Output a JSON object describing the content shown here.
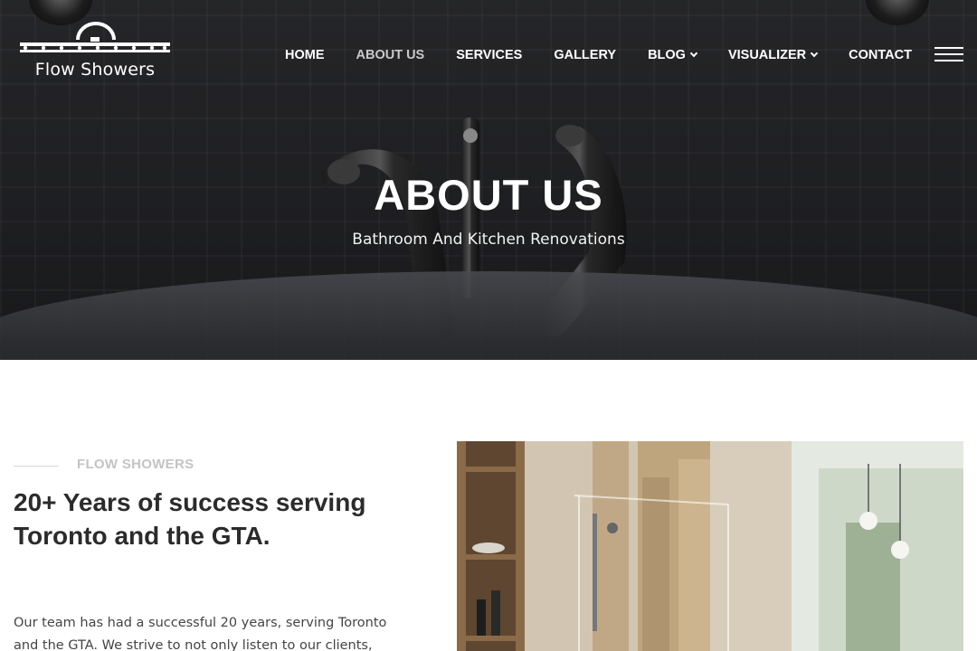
{
  "brand": {
    "name": "Flow Showers"
  },
  "nav": {
    "items": [
      {
        "label": "HOME",
        "active": false,
        "dropdown": false
      },
      {
        "label": "ABOUT US",
        "active": true,
        "dropdown": false
      },
      {
        "label": "SERVICES",
        "active": false,
        "dropdown": false
      },
      {
        "label": "GALLERY",
        "active": false,
        "dropdown": false
      },
      {
        "label": "BLOG",
        "active": false,
        "dropdown": true
      },
      {
        "label": "VISUALIZER",
        "active": false,
        "dropdown": true
      },
      {
        "label": "CONTACT",
        "active": false,
        "dropdown": false
      }
    ],
    "menu_icon": "hamburger-menu-icon"
  },
  "hero": {
    "title": "ABOUT US",
    "subtitle": "Bathroom And Kitchen Renovations"
  },
  "intro": {
    "eyebrow": "FLOW SHOWERS",
    "heading": "20+ Years of success serving Toronto and the GTA.",
    "paragraph": "Our team has had a successful 20 years, serving Toronto and the GTA. We strive to not only listen to our clients,"
  },
  "colors": {
    "hero_overlay": "#1e1f22",
    "nav_text": "#ffffff",
    "nav_active": "#c9c9c9",
    "heading": "#2b2b2b",
    "eyebrow": "#c4c4c4"
  }
}
